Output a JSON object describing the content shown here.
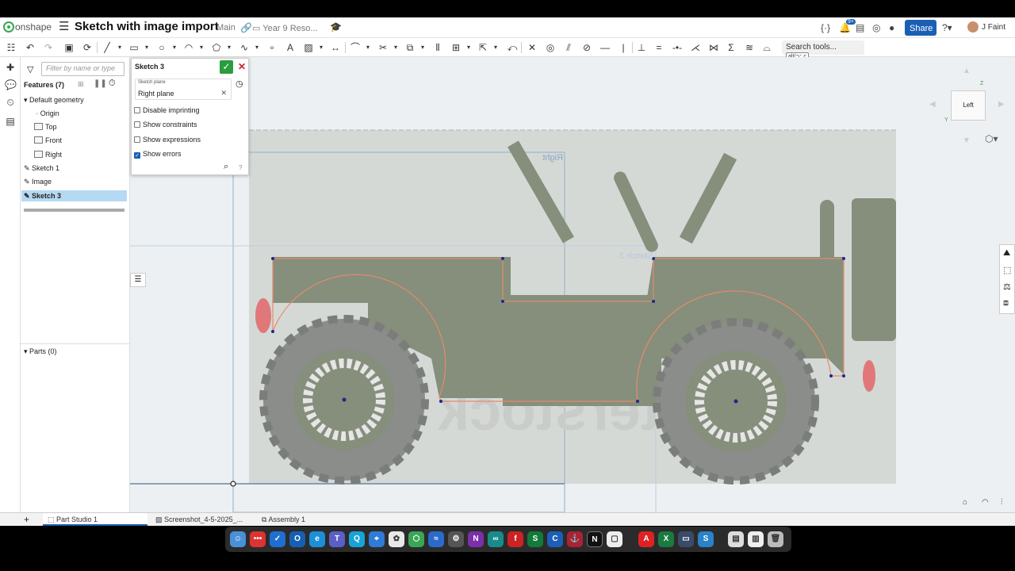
{
  "app": {
    "brand": "onshape",
    "doc_title": "Sketch with image import",
    "branch": "Main",
    "folder": "Year 9 Reso...",
    "share_label": "Share",
    "user": "J Faint",
    "notif_count": "9+",
    "accent": "#1a5fb4"
  },
  "toolbar": {
    "search_label": "Search tools...",
    "search_shortcut": "alt/⌥ c"
  },
  "features": {
    "filter_placeholder": "Filter by name or type",
    "header": "Features (7)",
    "default_geometry": "Default geometry",
    "origin": "Origin",
    "planes": [
      "Top",
      "Front",
      "Right"
    ],
    "items": [
      "Sketch 1",
      "Image",
      "Sketch 3"
    ],
    "parts": "Parts (0)"
  },
  "sketch_panel": {
    "title": "Sketch 3",
    "plane_label": "Sketch plane",
    "plane_value": "Right plane",
    "options": [
      {
        "label": "Disable imprinting",
        "checked": false
      },
      {
        "label": "Show constraints",
        "checked": false
      },
      {
        "label": "Show expressions",
        "checked": false
      },
      {
        "label": "Show errors",
        "checked": true
      }
    ]
  },
  "viewport": {
    "plane_label": "Right",
    "sketch_label": "Sketch 3",
    "view_cube": "Left",
    "axis_z": "Z",
    "axis_y": "Y",
    "watermark": "shutterstock",
    "jeep_color": "#858f7c",
    "sketch_line_color": "#e88a6a"
  },
  "tabs": [
    "Part Studio 1",
    "Screenshot_4-5-2025_...",
    "Assembly 1"
  ]
}
